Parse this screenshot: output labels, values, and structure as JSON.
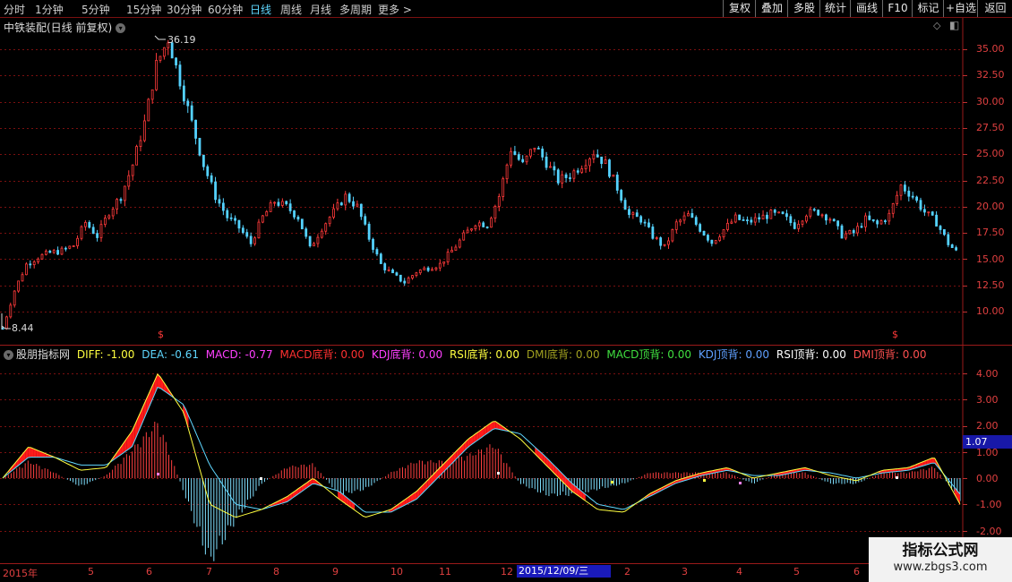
{
  "toolbar": {
    "periods": [
      "分时",
      "1分钟",
      "5分钟",
      "15分钟",
      "30分钟",
      "60分钟",
      "日线",
      "周线",
      "月线",
      "多周期",
      "更多 >"
    ],
    "active_period": "日线",
    "buttons": [
      "复权",
      "叠加",
      "多股",
      "统计",
      "画线",
      "F10",
      "标记",
      "+自选",
      "返回"
    ]
  },
  "stock": {
    "title": "中铁装配(日线 前复权)",
    "high_label": "36.19",
    "low_label": "8.44"
  },
  "price_axis": {
    "ticks": [
      "35.00",
      "32.50",
      "30.00",
      "27.50",
      "25.00",
      "22.50",
      "20.00",
      "17.50",
      "15.00",
      "12.50",
      "10.00"
    ]
  },
  "indicator": {
    "name": "股朋指标网",
    "items": [
      {
        "text": "DIFF: -1.00",
        "color": "#ffff40"
      },
      {
        "text": "DEA: -0.61",
        "color": "#5fd7ff"
      },
      {
        "text": "MACD: -0.77",
        "color": "#ff40ff"
      },
      {
        "text": "MACD底背: 0.00",
        "color": "#ff3030"
      },
      {
        "text": "KDJ底背: 0.00",
        "color": "#ff40ff"
      },
      {
        "text": "RSI底背: 0.00",
        "color": "#ffff40"
      },
      {
        "text": "DMI底背: 0.00",
        "color": "#a0a020"
      },
      {
        "text": "MACD顶背: 0.00",
        "color": "#40e040"
      },
      {
        "text": "KDJ顶背: 0.00",
        "color": "#5fa0ff"
      },
      {
        "text": "RSI顶背: 0.00",
        "color": "#ffffff"
      },
      {
        "text": "DMI顶背: 0.00",
        "color": "#ff5050"
      }
    ],
    "current_value": "1.07",
    "axis_ticks": [
      "4.00",
      "3.00",
      "2.00",
      "1.00",
      "0.00",
      "-1.00",
      "-2.00"
    ]
  },
  "time_axis": {
    "labels": [
      "2015年",
      "5",
      "6",
      "7",
      "8",
      "9",
      "10",
      "11",
      "12",
      "2",
      "3",
      "4",
      "5",
      "6"
    ],
    "selected_date": "2015/12/09/三"
  },
  "watermark": {
    "line1": "指标公式网",
    "line2": "www.zbgs3.com"
  },
  "chart_data": [
    {
      "type": "candlestick",
      "title": "中铁装配(日线 前复权)",
      "ylim": [
        8.44,
        36.19
      ],
      "y_ticks": [
        35.0,
        32.5,
        30.0,
        27.5,
        25.0,
        22.5,
        20.0,
        17.5,
        15.0,
        12.5,
        10.0
      ],
      "x_ticks": [
        "2015年",
        "5",
        "6",
        "7",
        "8",
        "9",
        "10",
        "11",
        "12",
        "2",
        "3",
        "4",
        "5",
        "6"
      ],
      "approx_close": [
        8.4,
        12,
        14.5,
        15.2,
        15.6,
        15.8,
        16.3,
        18.5,
        17.2,
        19.5,
        21,
        24,
        28,
        33.5,
        36,
        32,
        28,
        24,
        21,
        19,
        18,
        16.5,
        19,
        20.5,
        20,
        19,
        16,
        18,
        19.5,
        21,
        20,
        17,
        14.5,
        13.5,
        12.8,
        13.8,
        14.2,
        14.5,
        15.8,
        17.2,
        18.5,
        18.3,
        21,
        25.5,
        24,
        25.8,
        24.2,
        22.5,
        23,
        24,
        25.2,
        24.1,
        21.8,
        19.2,
        18.8,
        17.2,
        16.1,
        18.4,
        19.2,
        17.9,
        16.6,
        17.8,
        18.9,
        18.5,
        18.9,
        19.3,
        19.1,
        18.2,
        19.4,
        19.5,
        18.9,
        17.3,
        17.5,
        18.8,
        18.3,
        19.2,
        22,
        21,
        19.5,
        18.5,
        16.5,
        15.3
      ],
      "high": 36.19,
      "low": 8.44
    },
    {
      "type": "line",
      "title": "股朋指标网",
      "ylim": [
        -2.3,
        4.8
      ],
      "series": [
        {
          "name": "DIFF",
          "values": [
            0,
            1.2,
            0.8,
            0.3,
            0.4,
            1.8,
            4.0,
            2.5,
            -1.0,
            -1.5,
            -1.2,
            -0.7,
            0.0,
            -0.8,
            -1.5,
            -1.2,
            -0.5,
            0.5,
            1.5,
            2.2,
            1.5,
            0.5,
            -0.5,
            -1.2,
            -1.3,
            -0.6,
            -0.1,
            0.2,
            0.4,
            0.0,
            0.2,
            0.4,
            0.1,
            -0.1,
            0.3,
            0.4,
            0.8,
            -1.0
          ]
        },
        {
          "name": "DEA",
          "values": [
            0,
            0.8,
            0.8,
            0.5,
            0.5,
            1.2,
            3.5,
            2.8,
            0.5,
            -1.0,
            -1.2,
            -0.9,
            -0.2,
            -0.5,
            -1.3,
            -1.3,
            -0.8,
            0.2,
            1.2,
            1.9,
            1.7,
            0.8,
            -0.2,
            -1.0,
            -1.2,
            -0.7,
            -0.2,
            0.1,
            0.3,
            0.1,
            0.1,
            0.3,
            0.2,
            0.0,
            0.2,
            0.3,
            0.6,
            -0.61
          ]
        },
        {
          "name": "MACD",
          "values": [
            0,
            0.6,
            0.2,
            -0.3,
            0.1,
            1.0,
            2.0,
            -0.5,
            -3.0,
            -1.5,
            -0.2,
            0.4,
            0.5,
            -0.6,
            -0.4,
            0.2,
            0.6,
            0.6,
            0.8,
            1.2,
            -0.2,
            -0.6,
            -0.6,
            -0.4,
            -0.2,
            0.2,
            0.2,
            0.2,
            0.2,
            -0.2,
            0.2,
            0.2,
            -0.2,
            -0.2,
            0.2,
            0.2,
            0.4,
            -0.77
          ]
        }
      ],
      "y_ticks": [
        4.0,
        3.0,
        2.0,
        1.0,
        0.0,
        -1.0,
        -2.0
      ],
      "current_value": 1.07
    }
  ]
}
